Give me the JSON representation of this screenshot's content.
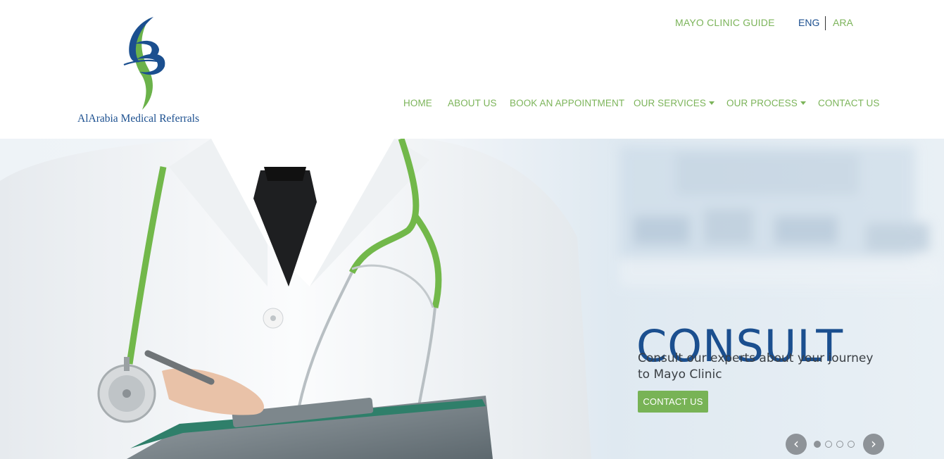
{
  "brand": {
    "name": "AlArabia Medical Referrals",
    "primary_color": "#1b4f8f",
    "accent_color": "#7cb45a"
  },
  "topbar": {
    "guide_label": "MAYO CLINIC GUIDE",
    "lang_en": "ENG",
    "lang_ar": "ARA"
  },
  "nav": {
    "items": [
      {
        "label": "HOME",
        "dropdown": false
      },
      {
        "label": "ABOUT US",
        "dropdown": false
      },
      {
        "label": "BOOK AN APPOINTMENT",
        "dropdown": false
      },
      {
        "label": "OUR SERVICES",
        "dropdown": true
      },
      {
        "label": "OUR PROCESS",
        "dropdown": true
      },
      {
        "label": "CONTACT US",
        "dropdown": false
      }
    ]
  },
  "hero": {
    "title": "CONSULT",
    "text": "Consult our experts about your journey to Mayo Clinic",
    "button_label": "CONTACT US",
    "image_description_icon": "doctor-with-stethoscope-image",
    "slide_count": 4,
    "active_slide": 1,
    "prev_icon": "chevron-left-icon",
    "next_icon": "chevron-right-icon"
  }
}
